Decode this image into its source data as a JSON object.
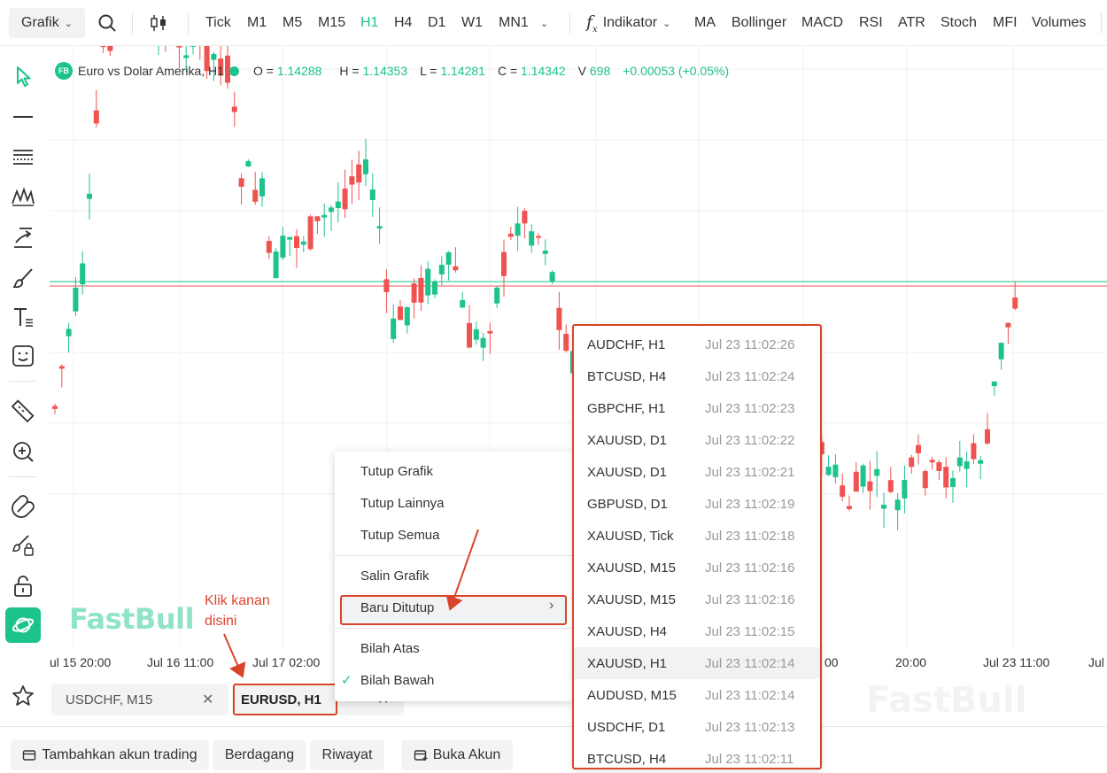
{
  "toolbar": {
    "chart_menu": "Grafik",
    "timeframes": [
      "Tick",
      "M1",
      "M5",
      "M15",
      "H1",
      "H4",
      "D1",
      "W1",
      "MN1"
    ],
    "active_timeframe": "H1",
    "indicator_label": "Indikator",
    "indicators": [
      "MA",
      "Bollinger",
      "MACD",
      "RSI",
      "ATR",
      "Stoch",
      "MFI",
      "Volumes"
    ]
  },
  "sidebar": {
    "icons": [
      "cursor-icon",
      "horizontal-line-icon",
      "fib-lines-icon",
      "pattern-icon",
      "trend-arrow-icon",
      "brush-icon",
      "text-icon",
      "emoji-icon",
      "ruler-icon",
      "zoom-in-icon",
      "magnet-icon",
      "lock-drawing-icon",
      "unlock-icon",
      "layers-icon",
      "favorite-star-icon"
    ]
  },
  "chart_header": {
    "badge": "FB",
    "title": "Euro vs Dolar Amerika, H1",
    "open_label": "O =",
    "open": "1.14288",
    "high_label": "H =",
    "high": "1.14353",
    "low_label": "L =",
    "low": "1.14281",
    "close_label": "C =",
    "close": "1.14342",
    "volume_label": "V",
    "volume": "698",
    "change": "+0.00053 (+0.05%)"
  },
  "watermark": "FastBull",
  "time_axis": [
    "ul 15 20:00",
    "Jul 16 11:00",
    "Jul 17 02:00",
    "00",
    "20:00",
    "Jul 23 11:00",
    "Jul"
  ],
  "tabs": [
    {
      "label": "USDCHF, M15",
      "active": false
    },
    {
      "label": "EURUSD, H1",
      "active": true
    }
  ],
  "annotation": "Klik kanan disini",
  "context_menu": {
    "group1": [
      "Tutup Grafik",
      "Tutup Lainnya",
      "Tutup Semua"
    ],
    "group2": [
      "Salin Grafik",
      "Baru Ditutup"
    ],
    "group3": [
      "Bilah Atas",
      "Bilah Bawah"
    ],
    "checked": "Bilah Bawah"
  },
  "recently_closed": [
    {
      "symbol": "AUDCHF, H1",
      "time": "Jul 23 11:02:26"
    },
    {
      "symbol": "BTCUSD, H4",
      "time": "Jul 23 11:02:24"
    },
    {
      "symbol": "GBPCHF, H1",
      "time": "Jul 23 11:02:23"
    },
    {
      "symbol": "XAUUSD, D1",
      "time": "Jul 23 11:02:22"
    },
    {
      "symbol": "XAUUSD, D1",
      "time": "Jul 23 11:02:21"
    },
    {
      "symbol": "GBPUSD, D1",
      "time": "Jul 23 11:02:19"
    },
    {
      "symbol": "XAUUSD, Tick",
      "time": "Jul 23 11:02:18"
    },
    {
      "symbol": "XAUUSD, M15",
      "time": "Jul 23 11:02:16"
    },
    {
      "symbol": "XAUUSD, M15",
      "time": "Jul 23 11:02:16"
    },
    {
      "symbol": "XAUUSD, H4",
      "time": "Jul 23 11:02:15"
    },
    {
      "symbol": "XAUUSD, H1",
      "time": "Jul 23 11:02:14"
    },
    {
      "symbol": "AUDUSD, M15",
      "time": "Jul 23 11:02:14"
    },
    {
      "symbol": "USDCHF, D1",
      "time": "Jul 23 11:02:13"
    },
    {
      "symbol": "BTCUSD, H4",
      "time": "Jul 23 11:02:11"
    }
  ],
  "bottom_buttons": [
    "Tambahkan akun trading",
    "Berdagang",
    "Riwayat",
    "Buka Akun"
  ],
  "colors": {
    "accent": "#1cc38a",
    "bear": "#ef5350",
    "annotation": "#d9452b"
  }
}
